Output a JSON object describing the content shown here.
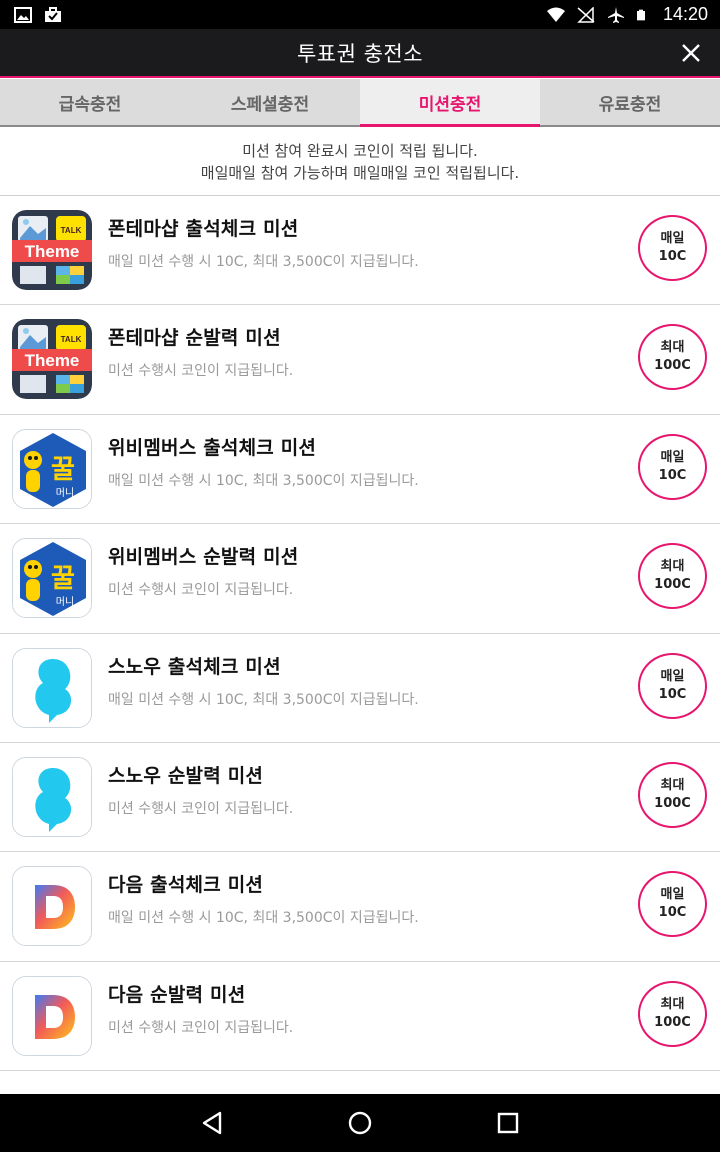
{
  "status_bar": {
    "time": "14:20",
    "icons": [
      "image-icon",
      "briefcase-icon",
      "wifi-icon",
      "no-signal-icon",
      "airplane-icon",
      "battery-icon"
    ]
  },
  "header": {
    "title": "투표권 충전소",
    "close_icon": "close-icon"
  },
  "tabs": [
    {
      "label": "급속충전",
      "active": false
    },
    {
      "label": "스페셜충전",
      "active": false
    },
    {
      "label": "미션충전",
      "active": true
    },
    {
      "label": "유료충전",
      "active": false
    }
  ],
  "notice": {
    "line1": "미션 참여 완료시 코인이 적립 됩니다.",
    "line2": "매일매일 참여 가능하며 매일매일 코인 적립됩니다."
  },
  "missions": [
    {
      "icon": "theme-shop-icon",
      "icon_text": "Theme",
      "badge_text": "TALK",
      "title": "폰테마샵 출석체크 미션",
      "desc": "매일 미션 수행 시 10C, 최대 3,500C이 지급됩니다.",
      "reward_line1": "매일",
      "reward_line2": "10C"
    },
    {
      "icon": "theme-shop-icon",
      "icon_text": "Theme",
      "badge_text": "TALK",
      "title": "폰테마샵 순발력 미션",
      "desc": "미션 수행시 코인이 지급됩니다.",
      "reward_line1": "최대",
      "reward_line2": "100C"
    },
    {
      "icon": "honey-money-icon",
      "icon_text": "꿀",
      "icon_subtext": "머니",
      "title": "위비멤버스 출석체크 미션",
      "desc": "매일 미션 수행 시 10C, 최대 3,500C이 지급됩니다.",
      "reward_line1": "매일",
      "reward_line2": "10C"
    },
    {
      "icon": "honey-money-icon",
      "icon_text": "꿀",
      "icon_subtext": "머니",
      "title": "위비멤버스 순발력 미션",
      "desc": "미션 수행시 코인이 지급됩니다.",
      "reward_line1": "최대",
      "reward_line2": "100C"
    },
    {
      "icon": "snow-icon",
      "title": "스노우 출석체크 미션",
      "desc": "매일 미션 수행 시 10C, 최대 3,500C이 지급됩니다.",
      "reward_line1": "매일",
      "reward_line2": "10C"
    },
    {
      "icon": "snow-icon",
      "title": "스노우 순발력 미션",
      "desc": "미션 수행시 코인이 지급됩니다.",
      "reward_line1": "최대",
      "reward_line2": "100C"
    },
    {
      "icon": "daum-icon",
      "title": "다음 출석체크 미션",
      "desc": "매일 미션 수행 시 10C, 최대 3,500C이 지급됩니다.",
      "reward_line1": "매일",
      "reward_line2": "10C"
    },
    {
      "icon": "daum-icon",
      "title": "다음 순발력 미션",
      "desc": "미션 수행시 코인이 지급됩니다.",
      "reward_line1": "최대",
      "reward_line2": "100C"
    }
  ],
  "nav_bar": {
    "icons": [
      "back-icon",
      "home-icon",
      "recents-icon"
    ]
  },
  "colors": {
    "accent": "#e6166f",
    "header_bg": "#1b1b1d",
    "tab_bg": "#dddcdd"
  }
}
